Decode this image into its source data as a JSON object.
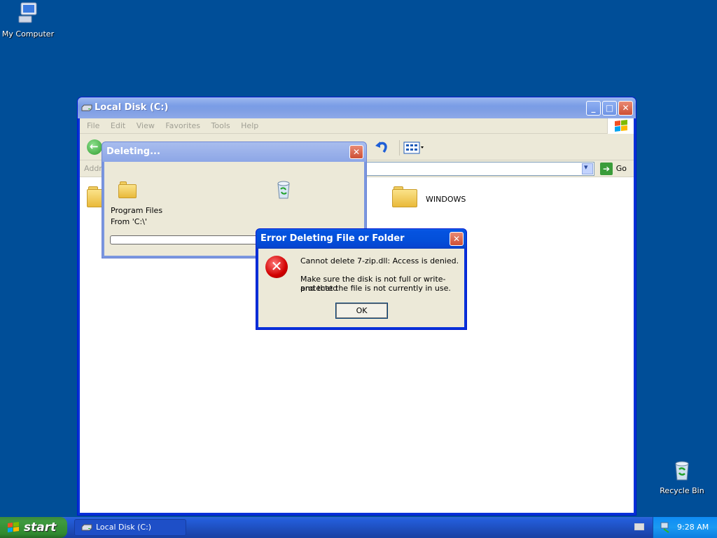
{
  "desktop": {
    "my_computer_label": "My Computer",
    "recycle_bin_label": "Recycle Bin"
  },
  "explorer": {
    "title": "Local Disk (C:)",
    "menu": [
      "File",
      "Edit",
      "View",
      "Favorites",
      "Tools",
      "Help"
    ],
    "address_label": "Addre",
    "go_label": "Go",
    "folders": [
      {
        "name": ""
      },
      {
        "name": "WINDOWS"
      }
    ]
  },
  "deleting_dialog": {
    "title": "Deleting...",
    "item": "Program Files",
    "from": "From 'C:\\'"
  },
  "error_dialog": {
    "title": "Error Deleting File or Folder",
    "message": "Cannot delete 7-zip.dll: Access is denied.",
    "detail_line1": "Make sure the disk is not full or write-protected",
    "detail_line2": "and that the file is not currently in use.",
    "ok_label": "OK"
  },
  "taskbar": {
    "start_label": "start",
    "task_label": "Local Disk (C:)",
    "clock": "9:28 AM"
  },
  "colors": {
    "desktop": "#004e98",
    "title_active": "#0350da",
    "taskbar": "#245edb",
    "start": "#3f9a3f",
    "error": "#d10000"
  }
}
